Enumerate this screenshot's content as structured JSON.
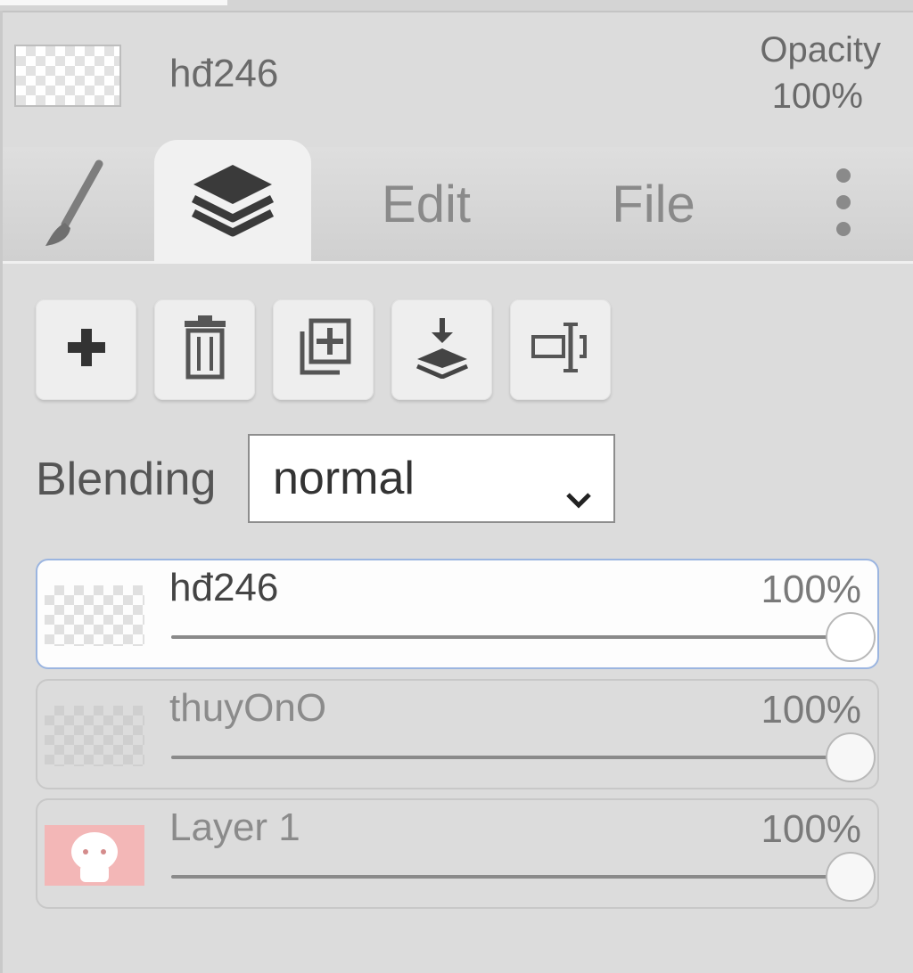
{
  "header": {
    "layer_name": "hđ246",
    "opacity_label": "Opacity",
    "opacity_value": "100%"
  },
  "tabs": [
    {
      "id": "brush",
      "label": "",
      "icon": "brush-icon"
    },
    {
      "id": "layers",
      "label": "",
      "icon": "layers-icon",
      "active": true
    },
    {
      "id": "edit",
      "label": "Edit"
    },
    {
      "id": "file",
      "label": "File"
    },
    {
      "id": "more",
      "label": "",
      "icon": "more-vertical-icon"
    }
  ],
  "actions": [
    {
      "id": "add-layer",
      "icon": "plus-icon"
    },
    {
      "id": "delete-layer",
      "icon": "trash-icon"
    },
    {
      "id": "duplicate-layer",
      "icon": "duplicate-icon"
    },
    {
      "id": "merge-down",
      "icon": "merge-down-icon"
    },
    {
      "id": "rename-layer",
      "icon": "rename-icon"
    }
  ],
  "blending": {
    "label": "Blending",
    "value": "normal"
  },
  "layers": [
    {
      "name": "hđ246",
      "opacity": "100%",
      "opacity_fraction": 1.0,
      "active": true,
      "thumbnail": "transparent"
    },
    {
      "name": "thuyOnO",
      "opacity": "100%",
      "opacity_fraction": 1.0,
      "active": false,
      "thumbnail": "transparent"
    },
    {
      "name": "Layer 1",
      "opacity": "100%",
      "opacity_fraction": 1.0,
      "active": false,
      "thumbnail": "pink-character"
    }
  ],
  "colors": {
    "panel_bg": "#dcdcdc",
    "active_tab_bg": "#f1f1f1",
    "active_layer_border": "#9bb5e0",
    "thumb_pink": "#f3b7b7"
  }
}
